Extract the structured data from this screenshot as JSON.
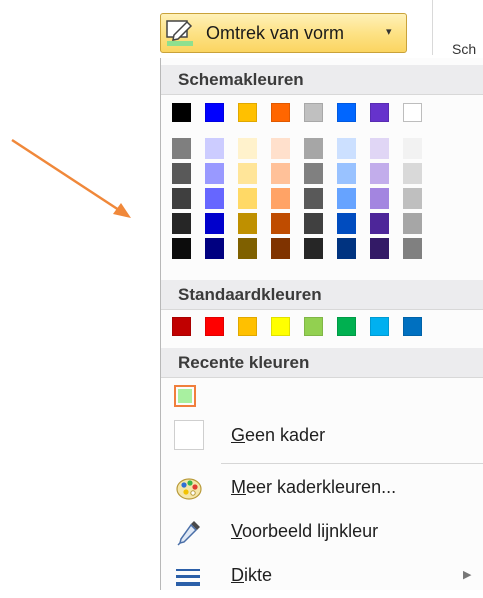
{
  "ribbon": {
    "button_label": "Omtrek van vorm",
    "caret": "▾",
    "current_color": "#8fe08f",
    "next_group_label": "Sch"
  },
  "menu": {
    "theme_section": {
      "title": "Schemakleuren",
      "base_colors": [
        "#000000",
        "#0000ff",
        "#ffc000",
        "#ff6600",
        "#c0c0c0",
        "#0066ff",
        "#6633cc",
        "#ffffff"
      ],
      "shades": [
        [
          "#7f7f7f",
          "#595959",
          "#3f3f3f",
          "#262626",
          "#0c0c0c"
        ],
        [
          "#ccccff",
          "#9999ff",
          "#6666ff",
          "#0000cc",
          "#000080"
        ],
        [
          "#fff2cc",
          "#ffe599",
          "#ffd966",
          "#bf9000",
          "#7f6000"
        ],
        [
          "#ffe0cc",
          "#ffc199",
          "#ffa366",
          "#bf4c00",
          "#7f3300"
        ],
        [
          "#a6a6a6",
          "#808080",
          "#595959",
          "#404040",
          "#262626"
        ],
        [
          "#cce0ff",
          "#99c2ff",
          "#66a3ff",
          "#004cbf",
          "#003380"
        ],
        [
          "#e0d6f5",
          "#c2adeb",
          "#a385e0",
          "#4d2699",
          "#331a66"
        ],
        [
          "#f2f2f2",
          "#d9d9d9",
          "#bfbfbf",
          "#a6a6a6",
          "#808080"
        ]
      ]
    },
    "standard_section": {
      "title": "Standaardkleuren",
      "colors": [
        "#c00000",
        "#ff0000",
        "#ffc000",
        "#ffff00",
        "#92d050",
        "#00b050",
        "#00b0f0",
        "#0070c0"
      ]
    },
    "recent_section": {
      "title": "Recente kleuren",
      "colors": [
        "#a8f0a0"
      ]
    },
    "items": {
      "no_outline": {
        "hotkey": "G",
        "rest": "een kader",
        "icon": "empty-box-icon"
      },
      "more_colors": {
        "hotkey": "M",
        "rest": "eer kaderkleuren...",
        "icon": "palette-icon"
      },
      "eyedropper": {
        "hotkey": "V",
        "rest": "oorbeeld lijnkleur",
        "icon": "eyedropper-icon"
      },
      "weight": {
        "hotkey": "D",
        "rest": "ikte",
        "icon": "line-weight-icon",
        "arrow": "▶"
      }
    }
  }
}
